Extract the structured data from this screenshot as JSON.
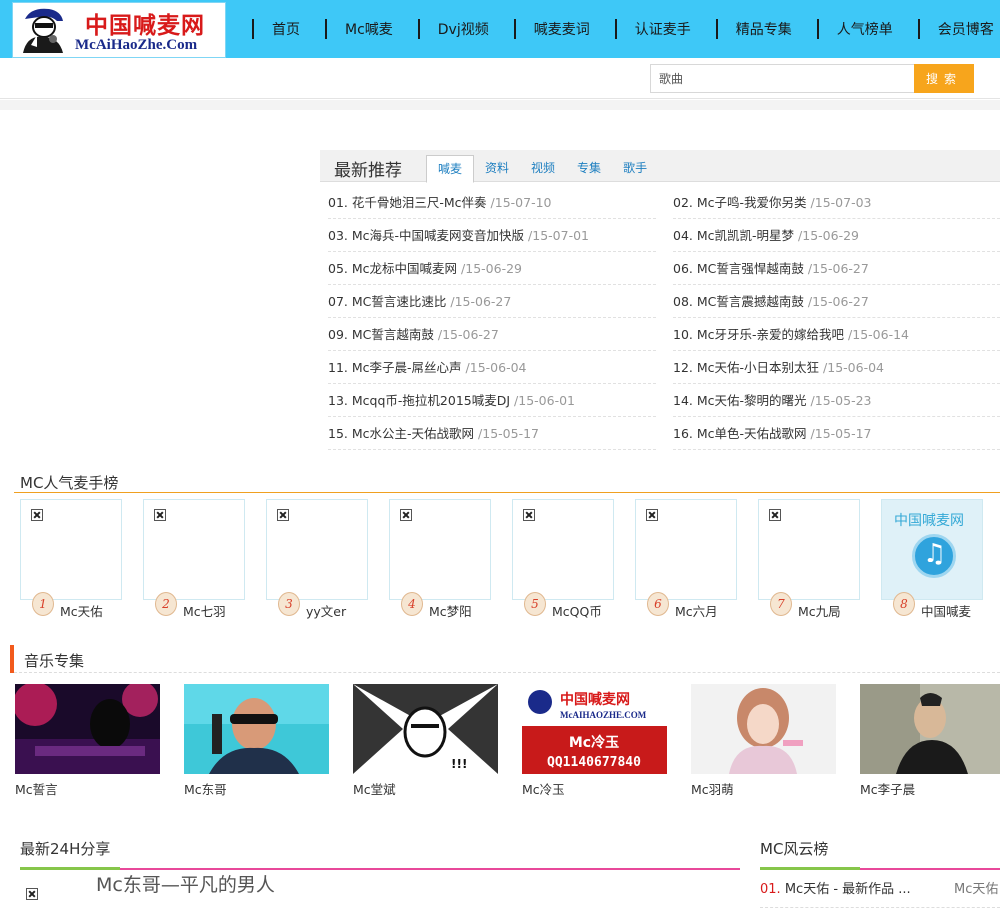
{
  "header": {
    "logo_cn": "中国喊麦网",
    "logo_en": "McAiHaoZhe.Com",
    "nav": [
      "首页",
      "Mc喊麦",
      "Dvj视频",
      "喊麦麦词",
      "认证麦手",
      "精品专集",
      "人气榜单",
      "会员博客"
    ]
  },
  "search": {
    "value": "歌曲",
    "button": "搜索"
  },
  "latest": {
    "title": "最新推荐",
    "tabs": [
      "喊麦",
      "资料",
      "视频",
      "专集",
      "歌手"
    ],
    "songs": [
      {
        "no": "01.",
        "title": "花千骨她泪三尺-Mc伴奏",
        "date": "/15-07-10"
      },
      {
        "no": "02.",
        "title": "Mc子鸣-我爱你另类",
        "date": "/15-07-03"
      },
      {
        "no": "03.",
        "title": "Mc海兵-中国喊麦网变音加快版",
        "date": "/15-07-01"
      },
      {
        "no": "04.",
        "title": "Mc凯凯凯-明星梦",
        "date": "/15-06-29"
      },
      {
        "no": "05.",
        "title": "Mc龙标中国喊麦网",
        "date": "/15-06-29"
      },
      {
        "no": "06.",
        "title": "MC誓言强悍越南鼓",
        "date": "/15-06-27"
      },
      {
        "no": "07.",
        "title": "MC誓言速比速比",
        "date": "/15-06-27"
      },
      {
        "no": "08.",
        "title": "MC誓言震撼越南鼓",
        "date": "/15-06-27"
      },
      {
        "no": "09.",
        "title": "MC誓言越南鼓",
        "date": "/15-06-27"
      },
      {
        "no": "10.",
        "title": "Mc牙牙乐-亲爱的嫁给我吧",
        "date": "/15-06-14"
      },
      {
        "no": "11.",
        "title": "Mc李子晨-屌丝心声",
        "date": "/15-06-04"
      },
      {
        "no": "12.",
        "title": "Mc天佑-小日本别太狂",
        "date": "/15-06-04"
      },
      {
        "no": "13.",
        "title": "Mcqq币-拖拉机2015喊麦DJ",
        "date": "/15-06-01"
      },
      {
        "no": "14.",
        "title": "Mc天佑-黎明的曙光",
        "date": "/15-05-23"
      },
      {
        "no": "15.",
        "title": "Mc水公主-天佑战歌网",
        "date": "/15-05-17"
      },
      {
        "no": "16.",
        "title": "Mc单色-天佑战歌网",
        "date": "/15-05-17"
      }
    ]
  },
  "popular": {
    "title": "MC人气麦手榜",
    "items": [
      {
        "rank": "1",
        "name": "Mc天佑"
      },
      {
        "rank": "2",
        "name": "Mc七羽"
      },
      {
        "rank": "3",
        "name": "yy文er"
      },
      {
        "rank": "4",
        "name": "Mc梦阳"
      },
      {
        "rank": "5",
        "name": "McQQ币"
      },
      {
        "rank": "6",
        "name": "Mc六月"
      },
      {
        "rank": "7",
        "name": "Mc九局"
      },
      {
        "rank": "8",
        "name": "中国喊麦"
      }
    ],
    "cover_text": "中国喊麦网"
  },
  "albums": {
    "title": "音乐专集",
    "items": [
      {
        "name": "Mc誓言"
      },
      {
        "name": "Mc东哥"
      },
      {
        "name": "Mc堂斌"
      },
      {
        "name": "Mc冷玉",
        "poster": {
          "cn": "中国喊麦网",
          "en": "McAIHAOZHE.COM",
          "name": "Mc冷玉",
          "qq": "QQ1140677840"
        }
      },
      {
        "name": "Mc羽萌"
      },
      {
        "name": "Mc李子晨"
      }
    ]
  },
  "share": {
    "title": "最新24H分享",
    "item_title": "Mc东哥—平凡的男人"
  },
  "ranking": {
    "title": "MC风云榜",
    "items": [
      {
        "no": "01.",
        "title": "Mc天佑 - 最新作品 ...",
        "artist": "Mc天佑"
      }
    ]
  }
}
